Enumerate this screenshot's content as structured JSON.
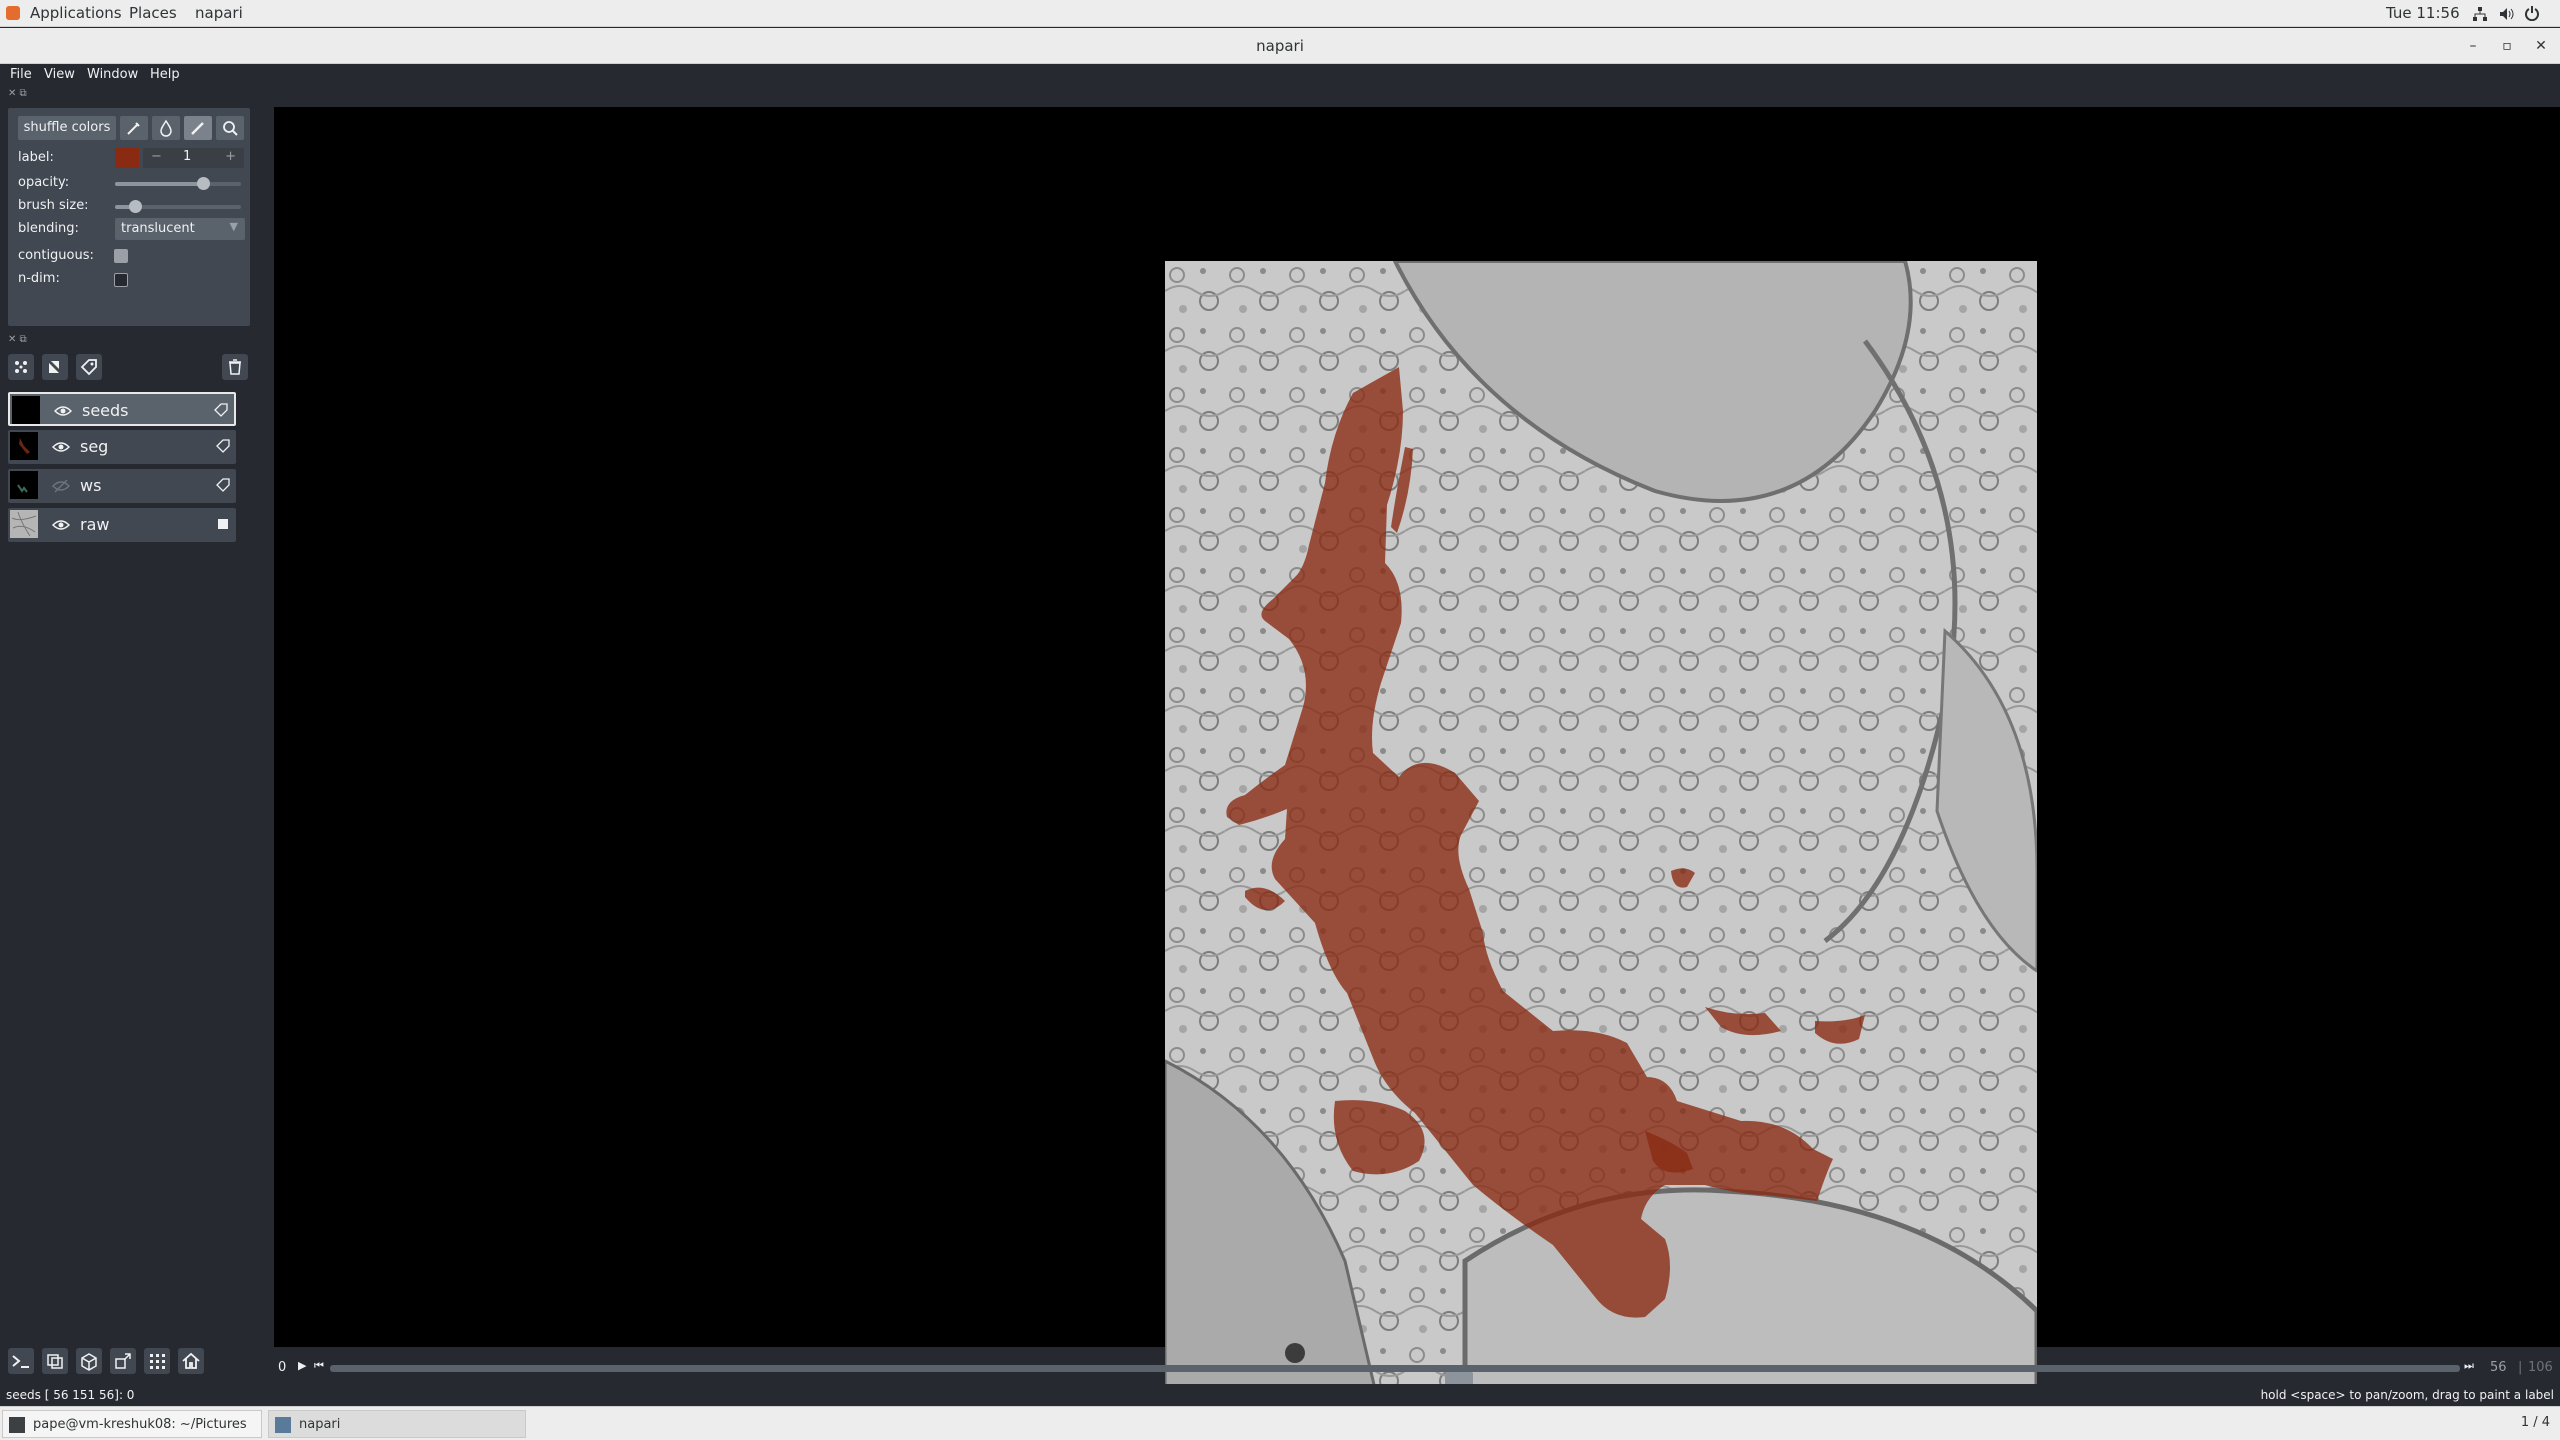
{
  "topbar": {
    "applications": "Applications",
    "places": "Places",
    "app": "napari",
    "clock": "Tue 11:56"
  },
  "window": {
    "title": "napari"
  },
  "menu": {
    "file": "File",
    "view": "View",
    "window": "Window",
    "help": "Help"
  },
  "controls": {
    "shuffle_colors": "shuffle colors",
    "label_label": "label:",
    "label_value": "1",
    "label_color": "#8b2a12",
    "opacity_label": "opacity:",
    "opacity_value": 0.7,
    "brush_size_label": "brush size:",
    "brush_size_value": 0.17,
    "blending_label": "blending:",
    "blending_value": "translucent",
    "contiguous_label": "contiguous:",
    "ndim_label": "n-dim:"
  },
  "layers": [
    {
      "name": "seeds",
      "selected": true,
      "visible": true,
      "type_icon": "label-icon"
    },
    {
      "name": "seg",
      "selected": false,
      "visible": true,
      "type_icon": "label-icon"
    },
    {
      "name": "ws",
      "selected": false,
      "visible": false,
      "type_icon": "label-icon"
    },
    {
      "name": "raw",
      "selected": false,
      "visible": true,
      "type_icon": "image-icon"
    }
  ],
  "dims": {
    "axis_label": "0",
    "current": "56",
    "total": "106",
    "slider_fraction": 0.53
  },
  "status": {
    "left": "seeds [ 56 151  56]: 0",
    "right": "hold <space> to pan/zoom, drag to paint a label"
  },
  "taskbar": {
    "terminal": "pape@vm-kreshuk08: ~/Pictures",
    "napari": "napari",
    "workspace": "1 / 4"
  },
  "colors": {
    "bg": "#262930",
    "panel": "#414851",
    "segment": "#8b2a12"
  }
}
